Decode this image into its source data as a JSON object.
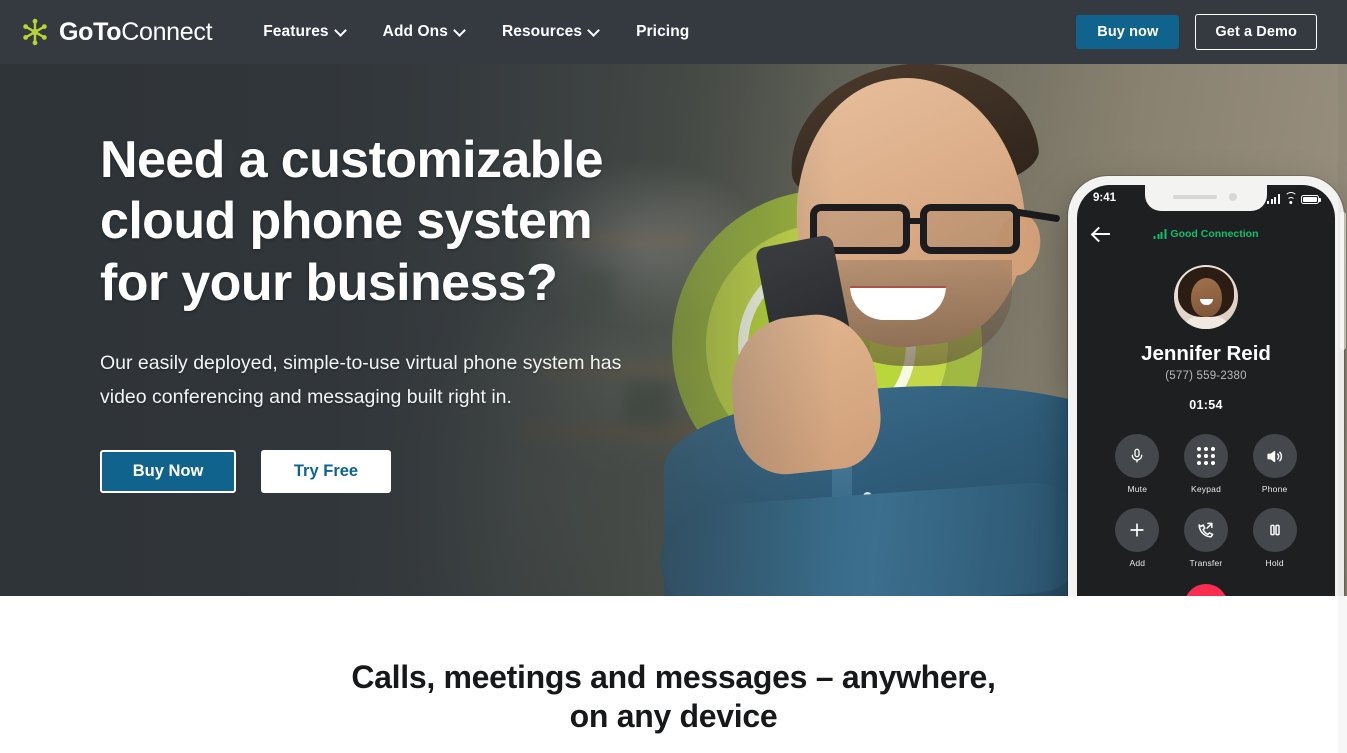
{
  "brand": {
    "name_bold": "GoTo",
    "name_light": "Connect",
    "logo_icon": "goto-asterisk-logo",
    "logo_color": "#b7d432"
  },
  "nav": {
    "items": [
      {
        "label": "Features",
        "has_dropdown": true,
        "icon": "chevron-down-icon"
      },
      {
        "label": "Add Ons",
        "has_dropdown": true,
        "icon": "chevron-down-icon"
      },
      {
        "label": "Resources",
        "has_dropdown": true,
        "icon": "chevron-down-icon"
      },
      {
        "label": "Pricing",
        "has_dropdown": false
      }
    ],
    "buy_now": "Buy now",
    "get_demo": "Get a Demo",
    "bg_color": "#343a40",
    "accent_color": "#10638c"
  },
  "hero": {
    "title_line1": "Need a customizable",
    "title_line2": "cloud phone system",
    "title_line3": "for your business?",
    "subtitle": "Our easily deployed, simple-to-use virtual phone system has video conferencing and messaging built right in.",
    "cta_primary": "Buy Now",
    "cta_secondary": "Try Free",
    "primary_color": "#10638c",
    "ring_color": "#b2d235"
  },
  "phone": {
    "status_time": "9:41",
    "status_icons": [
      "signal-icon",
      "wifi-icon",
      "battery-icon"
    ],
    "back_icon": "back-arrow-icon",
    "connection_label": "Good Connection",
    "connection_color": "#0fbf6e",
    "caller_name": "Jennifer Reid",
    "caller_number": "(577) 559-2380",
    "call_duration": "01:54",
    "controls": [
      {
        "label": "Mute",
        "icon": "microphone-icon"
      },
      {
        "label": "Keypad",
        "icon": "keypad-icon"
      },
      {
        "label": "Phone",
        "icon": "speaker-icon"
      },
      {
        "label": "Add",
        "icon": "plus-icon"
      },
      {
        "label": "Transfer",
        "icon": "call-transfer-icon"
      },
      {
        "label": "Hold",
        "icon": "pause-icon"
      }
    ],
    "end_call_icon": "end-call-icon",
    "end_call_color": "#fa2d50"
  },
  "section": {
    "title_line1": "Calls, meetings and messages – anywhere,",
    "title_line2": "on any device"
  }
}
